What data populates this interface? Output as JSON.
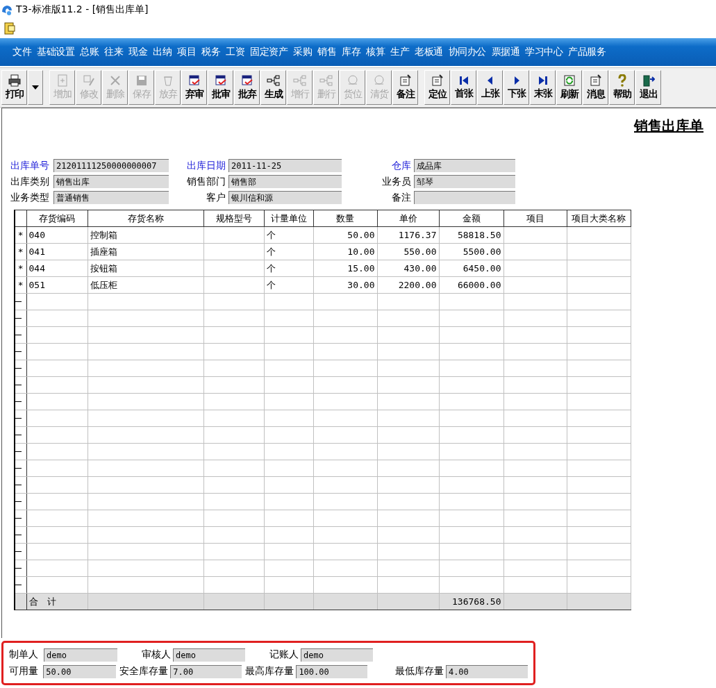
{
  "window": {
    "title": "T3-标准版11.2 - [销售出库单]"
  },
  "menu": [
    "文件",
    "基础设置",
    "总账",
    "往来",
    "现金",
    "出纳",
    "项目",
    "税务",
    "工资",
    "固定资产",
    "采购",
    "销售",
    "库存",
    "核算",
    "生产",
    "老板通",
    "协同办公",
    "票据通",
    "学习中心",
    "产品服务"
  ],
  "toolbar": [
    {
      "label": "打印",
      "kind": "print",
      "disabled": false
    },
    {
      "kind": "dropdown"
    },
    {
      "label": "增加",
      "kind": "add",
      "disabled": true
    },
    {
      "label": "修改",
      "kind": "edit",
      "disabled": true
    },
    {
      "label": "删除",
      "kind": "delete",
      "disabled": true
    },
    {
      "label": "保存",
      "kind": "save",
      "disabled": true
    },
    {
      "label": "放弃",
      "kind": "discard",
      "disabled": true
    },
    {
      "label": "弃审",
      "kind": "audit",
      "disabled": false
    },
    {
      "label": "批审",
      "kind": "audit",
      "disabled": false
    },
    {
      "label": "批弃",
      "kind": "audit",
      "disabled": false
    },
    {
      "label": "生成",
      "kind": "tree",
      "disabled": false
    },
    {
      "label": "增行",
      "kind": "tree",
      "disabled": true
    },
    {
      "label": "删行",
      "kind": "tree",
      "disabled": true
    },
    {
      "label": "货位",
      "kind": "goods",
      "disabled": true
    },
    {
      "label": "清货",
      "kind": "goods",
      "disabled": true
    },
    {
      "label": "备注",
      "kind": "note",
      "disabled": false
    },
    {
      "label": "定位",
      "kind": "note",
      "disabled": false
    },
    {
      "label": "首张",
      "kind": "first",
      "disabled": false
    },
    {
      "label": "上张",
      "kind": "prev",
      "disabled": false
    },
    {
      "label": "下张",
      "kind": "next",
      "disabled": false
    },
    {
      "label": "末张",
      "kind": "last",
      "disabled": false
    },
    {
      "label": "刷新",
      "kind": "refresh",
      "disabled": false
    },
    {
      "label": "消息",
      "kind": "note",
      "disabled": false
    },
    {
      "label": "帮助",
      "kind": "help",
      "disabled": false
    },
    {
      "label": "退出",
      "kind": "exit",
      "disabled": false
    }
  ],
  "form_title": "销售出库单",
  "header_fields": [
    [
      {
        "label": "出库单号",
        "value": "21201111250000000007",
        "required": true
      },
      {
        "label": "出库日期",
        "value": "2011-11-25",
        "required": true
      },
      {
        "label": "仓库",
        "value": "成品库",
        "required": true
      }
    ],
    [
      {
        "label": "出库类别",
        "value": "销售出库",
        "required": false
      },
      {
        "label": "销售部门",
        "value": "销售部",
        "required": false
      },
      {
        "label": "业务员",
        "value": "邹琴",
        "required": false
      }
    ],
    [
      {
        "label": "业务类型",
        "value": "普通销售",
        "required": false
      },
      {
        "label": "客户",
        "value": "银川信和源",
        "required": false
      },
      {
        "label": "备注",
        "required": false
      }
    ]
  ],
  "table": {
    "columns": [
      "存货编码",
      "存货名称",
      "规格型号",
      "计量单位",
      "数量",
      "单价",
      "金额",
      "项目",
      "项目大类名称"
    ],
    "rows": [
      [
        "040",
        "控制箱",
        "",
        "个",
        "50.00",
        "1176.37",
        "58818.50",
        "",
        ""
      ],
      [
        "041",
        "插座箱",
        "",
        "个",
        "10.00",
        "550.00",
        "5500.00",
        "",
        ""
      ],
      [
        "044",
        "按钮箱",
        "",
        "个",
        "15.00",
        "430.00",
        "6450.00",
        "",
        ""
      ],
      [
        "051",
        "低压柜",
        "",
        "个",
        "30.00",
        "2200.00",
        "66000.00",
        "",
        ""
      ]
    ],
    "row_marker": "*",
    "total_label": "合　计",
    "total_amount": "136768.50"
  },
  "footer": {
    "highlighted": true,
    "fields": [
      [
        {
          "label": "制单人",
          "value": "demo"
        },
        {
          "label": "审核人",
          "value": "demo"
        },
        {
          "label": "记账人",
          "value": "demo"
        }
      ],
      [
        {
          "label": "可用量",
          "value": "50.00"
        },
        {
          "label": "安全库存量",
          "value": "7.00"
        },
        {
          "label": "最高库存量",
          "value": "100.00"
        },
        {
          "label": "最低库存量",
          "value": "4.00"
        }
      ]
    ]
  }
}
